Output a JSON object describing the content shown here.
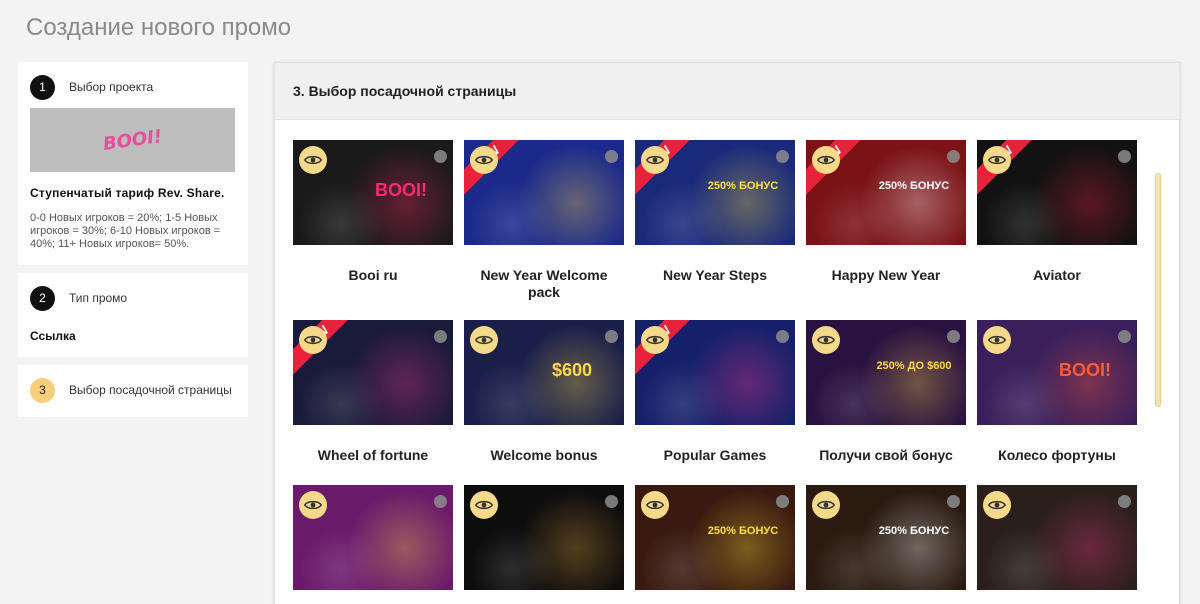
{
  "page": {
    "title": "Создание нового промо"
  },
  "steps": [
    {
      "num": "1",
      "label": "Выбор проекта",
      "project_logo": "BOOI!",
      "strong": "Ступенчатый тариф Rev. Share.",
      "desc": "0-0 Новых игроков = 20%; 1-5 Новых игроков = 30%; 6-10 Новых игроков = 40%; 11+ Новых игроков= 50%."
    },
    {
      "num": "2",
      "label": "Тип промо",
      "value": "Ссылка"
    },
    {
      "num": "3",
      "label": "Выбор посадочной страницы"
    }
  ],
  "panel": {
    "title": "3. Выбор посадочной страницы"
  },
  "landings": [
    {
      "title": "Booi ru",
      "bg": "#1a1a1a",
      "accent": "#ff2a6d",
      "new": false,
      "caption": "BOOI!"
    },
    {
      "title": "New Year Welcome pack",
      "bg": "#1b2a8a",
      "accent": "#ffd84a",
      "new": true,
      "caption": ""
    },
    {
      "title": "New Year Steps",
      "bg": "#1a2a7a",
      "accent": "#ffe13a",
      "new": true,
      "caption": "250% БОНУС"
    },
    {
      "title": "Happy New Year",
      "bg": "#7a1216",
      "accent": "#ffffff",
      "new": true,
      "caption": "250% БОНУС"
    },
    {
      "title": "Aviator",
      "bg": "#121212",
      "accent": "#e8223a",
      "new": true,
      "caption": ""
    },
    {
      "title": "Wheel of fortune",
      "bg": "#1a1a3a",
      "accent": "#e83a8a",
      "new": true,
      "caption": ""
    },
    {
      "title": "Welcome bonus",
      "bg": "#1a1f4a",
      "accent": "#ffd84a",
      "new": false,
      "caption": "$600"
    },
    {
      "title": "Popular Games",
      "bg": "#16206a",
      "accent": "#ff3a8a",
      "new": true,
      "caption": ""
    },
    {
      "title": "Получи свой бонус",
      "bg": "#2a1240",
      "accent": "#ffd84a",
      "new": false,
      "caption": "250% ДО $600"
    },
    {
      "title": "Колесо фортуны",
      "bg": "#3a1f5a",
      "accent": "#ff5a3a",
      "new": false,
      "caption": "BOOI!"
    },
    {
      "title": "",
      "bg": "#6a1a6a",
      "accent": "#ffd84a",
      "new": false,
      "caption": ""
    },
    {
      "title": "",
      "bg": "#0d0d0d",
      "accent": "#e0a040",
      "new": false,
      "caption": ""
    },
    {
      "title": "",
      "bg": "#3a1a10",
      "accent": "#ffe13a",
      "new": false,
      "caption": "250% БОНУС"
    },
    {
      "title": "",
      "bg": "#2a1a10",
      "accent": "#ffffff",
      "new": false,
      "caption": "250% БОНУС"
    },
    {
      "title": "",
      "bg": "#2a1f1a",
      "accent": "#e83a8a",
      "new": false,
      "caption": ""
    }
  ],
  "icons": {
    "preview": "eye-icon",
    "select": "select-radio-icon",
    "new_badge": "new-ribbon"
  },
  "labels": {
    "new_ribbon": "NEW"
  },
  "colors": {
    "active_step": "#f5cf7a",
    "scrollbar": "#f5e4b3",
    "ribbon": "#e8223a"
  }
}
